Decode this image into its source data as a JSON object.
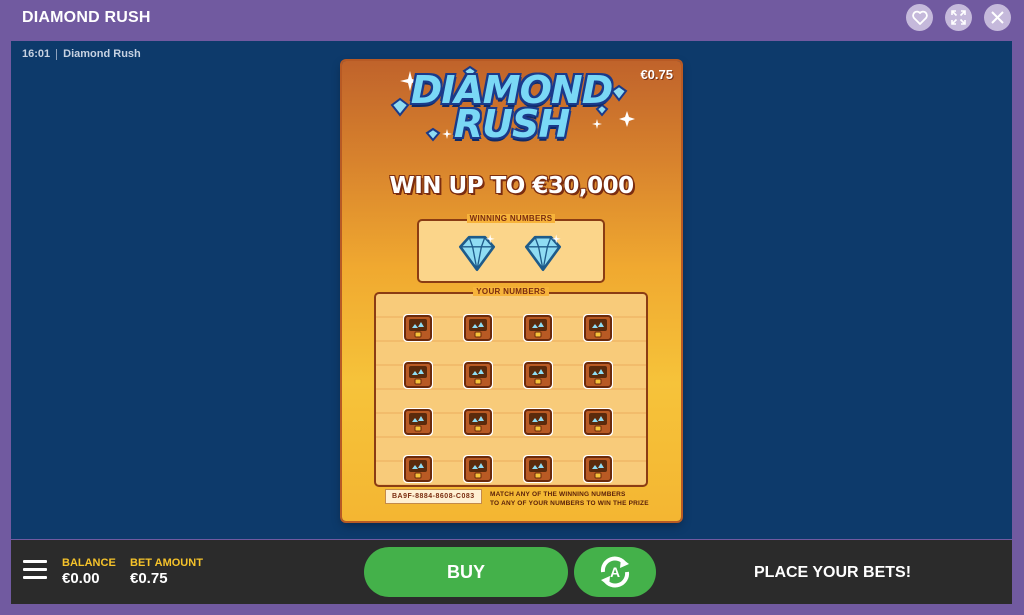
{
  "app": {
    "title": "DIAMOND RUSH"
  },
  "top_icons": {
    "favorite": "heart-icon",
    "fullscreen": "expand-icon",
    "close": "close-icon"
  },
  "game": {
    "time": "16:01",
    "name": "Diamond Rush"
  },
  "ticket": {
    "price": "€0.75",
    "logo_line1": "DIAMOND",
    "logo_line2": "RUSH",
    "headline": "WIN UP TO €30,000",
    "winning_numbers_label": "WINNING NUMBERS",
    "winning_numbers_count": 2,
    "your_numbers_label": "YOUR NUMBERS",
    "your_numbers_count": 16,
    "serial": "BA9F-8884-8608-C083",
    "instructions_line1": "MATCH ANY OF THE WINNING NUMBERS",
    "instructions_line2": "TO ANY OF YOUR NUMBERS TO WIN THE PRIZE",
    "colors": {
      "gem": "#8fdcf3",
      "gem_outline": "#1e5b8a",
      "chest": "#b85a24"
    }
  },
  "bottom": {
    "menu_icon": "hamburger-menu-icon",
    "balance_label": "BALANCE",
    "balance_value": "€0.00",
    "bet_label": "BET AMOUNT",
    "bet_value": "€0.75",
    "buy_label": "BUY",
    "autoplay_icon": "autoplay-icon",
    "status": "PLACE YOUR BETS!",
    "colors": {
      "buy": "#44b14a",
      "label": "#f6c32a"
    }
  }
}
